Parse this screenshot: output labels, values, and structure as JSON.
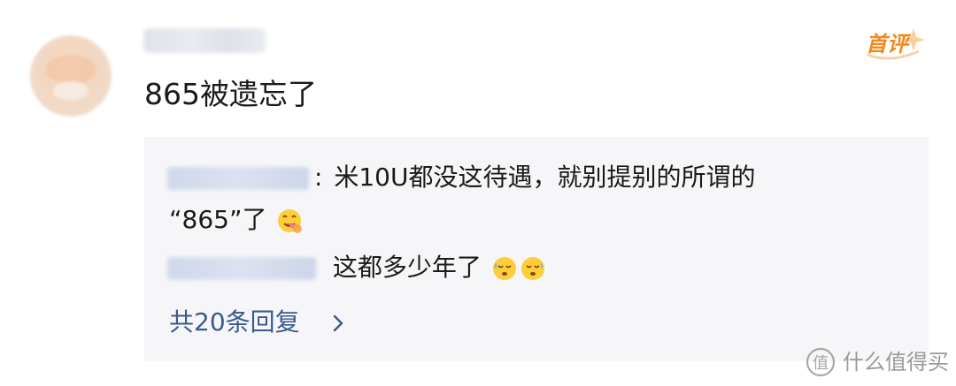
{
  "comment": {
    "badge_label": "首评",
    "text": "865被遗忘了",
    "colors": {
      "badge": "#f08a1c",
      "link": "#3a5a8c",
      "reply_box_bg": "#f6f6f8"
    }
  },
  "replies": [
    {
      "separator": ":",
      "text_line1": "米10U都没这待遇，就别提别的所谓的",
      "text_line2": "“865”了",
      "emoji": "yum-face-emoji"
    },
    {
      "text": "这都多少年了",
      "emoji": "sweat-face-emoji"
    }
  ],
  "more_replies_label": "共20条回复",
  "watermark": {
    "logo_icon": "zhi-circle-logo",
    "text": "什么值得买"
  }
}
